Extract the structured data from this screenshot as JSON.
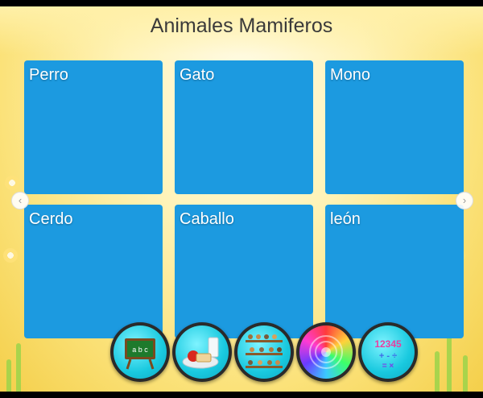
{
  "title": "Animales Mamiferos",
  "cards": [
    {
      "label": "Perro"
    },
    {
      "label": "Gato"
    },
    {
      "label": "Mono"
    },
    {
      "label": "Cerdo"
    },
    {
      "label": "Caballo"
    },
    {
      "label": "león"
    }
  ],
  "carousel": {
    "prev_icon": "chevron-left-icon",
    "next_icon": "chevron-right-icon",
    "prev_glyph": "‹",
    "next_glyph": "›"
  },
  "dock": [
    {
      "name": "abc-chalkboard-icon"
    },
    {
      "name": "food-plate-icon"
    },
    {
      "name": "animal-shelves-icon"
    },
    {
      "name": "color-spiral-icon"
    },
    {
      "name": "numbers-icon"
    }
  ],
  "chalkboard_text": "a b c",
  "numbers_text": "12345",
  "colors": {
    "card": "#1c9ae0",
    "dock_ring": "#19c9df"
  }
}
